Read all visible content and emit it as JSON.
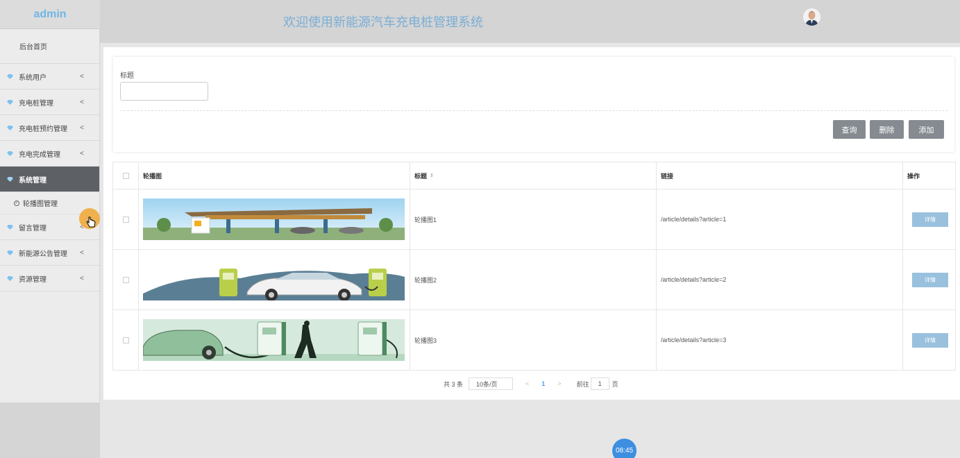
{
  "sidebar": {
    "brand": "admin",
    "home": "后台首页",
    "items": [
      {
        "label": "系统用户",
        "active": false
      },
      {
        "label": "充电桩管理",
        "active": false
      },
      {
        "label": "充电桩预约管理",
        "active": false
      },
      {
        "label": "充电完成管理",
        "active": false
      },
      {
        "label": "系统管理",
        "active": true
      }
    ],
    "submenu": [
      "轮播图管理"
    ],
    "items_after": [
      {
        "label": "留言管理"
      },
      {
        "label": "新能源公告管理"
      },
      {
        "label": "资源管理"
      }
    ],
    "chevron": "<"
  },
  "header": {
    "title": "欢迎使用新能源汽车充电桩管理系统"
  },
  "search": {
    "label": "标题",
    "value": "",
    "placeholder": ""
  },
  "buttons": {
    "query": "查询",
    "delete": "删除",
    "add": "添加"
  },
  "table": {
    "headers": [
      "轮播图",
      "标题",
      "链接",
      "操作"
    ],
    "rows": [
      {
        "title": "轮播图1",
        "link": "/article/details?article=1",
        "action": "详情",
        "image": "charging-station-canopy"
      },
      {
        "title": "轮播图2",
        "link": "/article/details?article=2",
        "action": "详情",
        "image": "white-car-charging"
      },
      {
        "title": "轮播图3",
        "link": "/article/details?article=3",
        "action": "详情",
        "image": "person-charging-green-car"
      }
    ]
  },
  "pagination": {
    "total": "共 3 条",
    "page_size": "10条/页",
    "prev": "<",
    "current": "1",
    "next": ">",
    "goto_label": "前往",
    "goto_value": "1",
    "goto_suffix": "页"
  },
  "timer": "08:45",
  "colors": {
    "accent": "#6fb6e6",
    "active_menu": "#5d6166",
    "button": "#858b90",
    "detail_button": "#99c1dd"
  }
}
